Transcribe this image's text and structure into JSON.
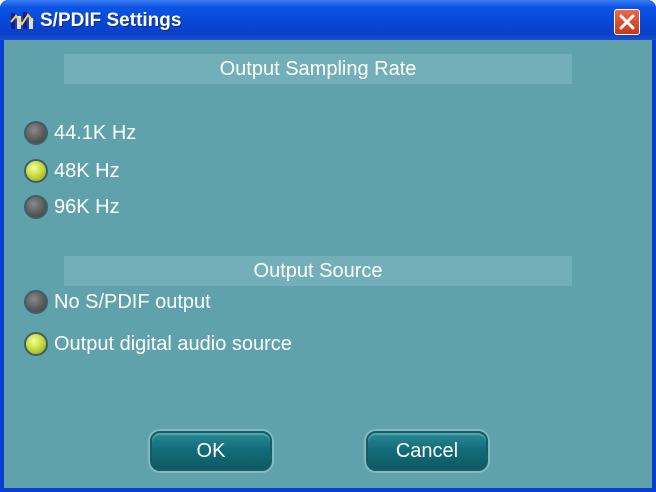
{
  "window": {
    "title": "S/PDIF Settings"
  },
  "sections": {
    "sampling_rate": {
      "header": "Output Sampling Rate",
      "options": [
        {
          "label": "44.1K Hz",
          "selected": false
        },
        {
          "label": "48K Hz",
          "selected": true
        },
        {
          "label": "96K Hz",
          "selected": false
        }
      ]
    },
    "output_source": {
      "header": "Output Source",
      "options": [
        {
          "label": "No S/PDIF output",
          "selected": false
        },
        {
          "label": "Output digital audio source",
          "selected": true
        }
      ]
    }
  },
  "buttons": {
    "ok_label": "OK",
    "cancel_label": "Cancel"
  },
  "colors": {
    "client_background": "#5fa2ab",
    "selected_radio": "#c8dc40",
    "unselected_radio": "#5b5b5b"
  },
  "icons": {
    "app_icon": "audio-app-icon",
    "close_icon": "close-icon"
  }
}
